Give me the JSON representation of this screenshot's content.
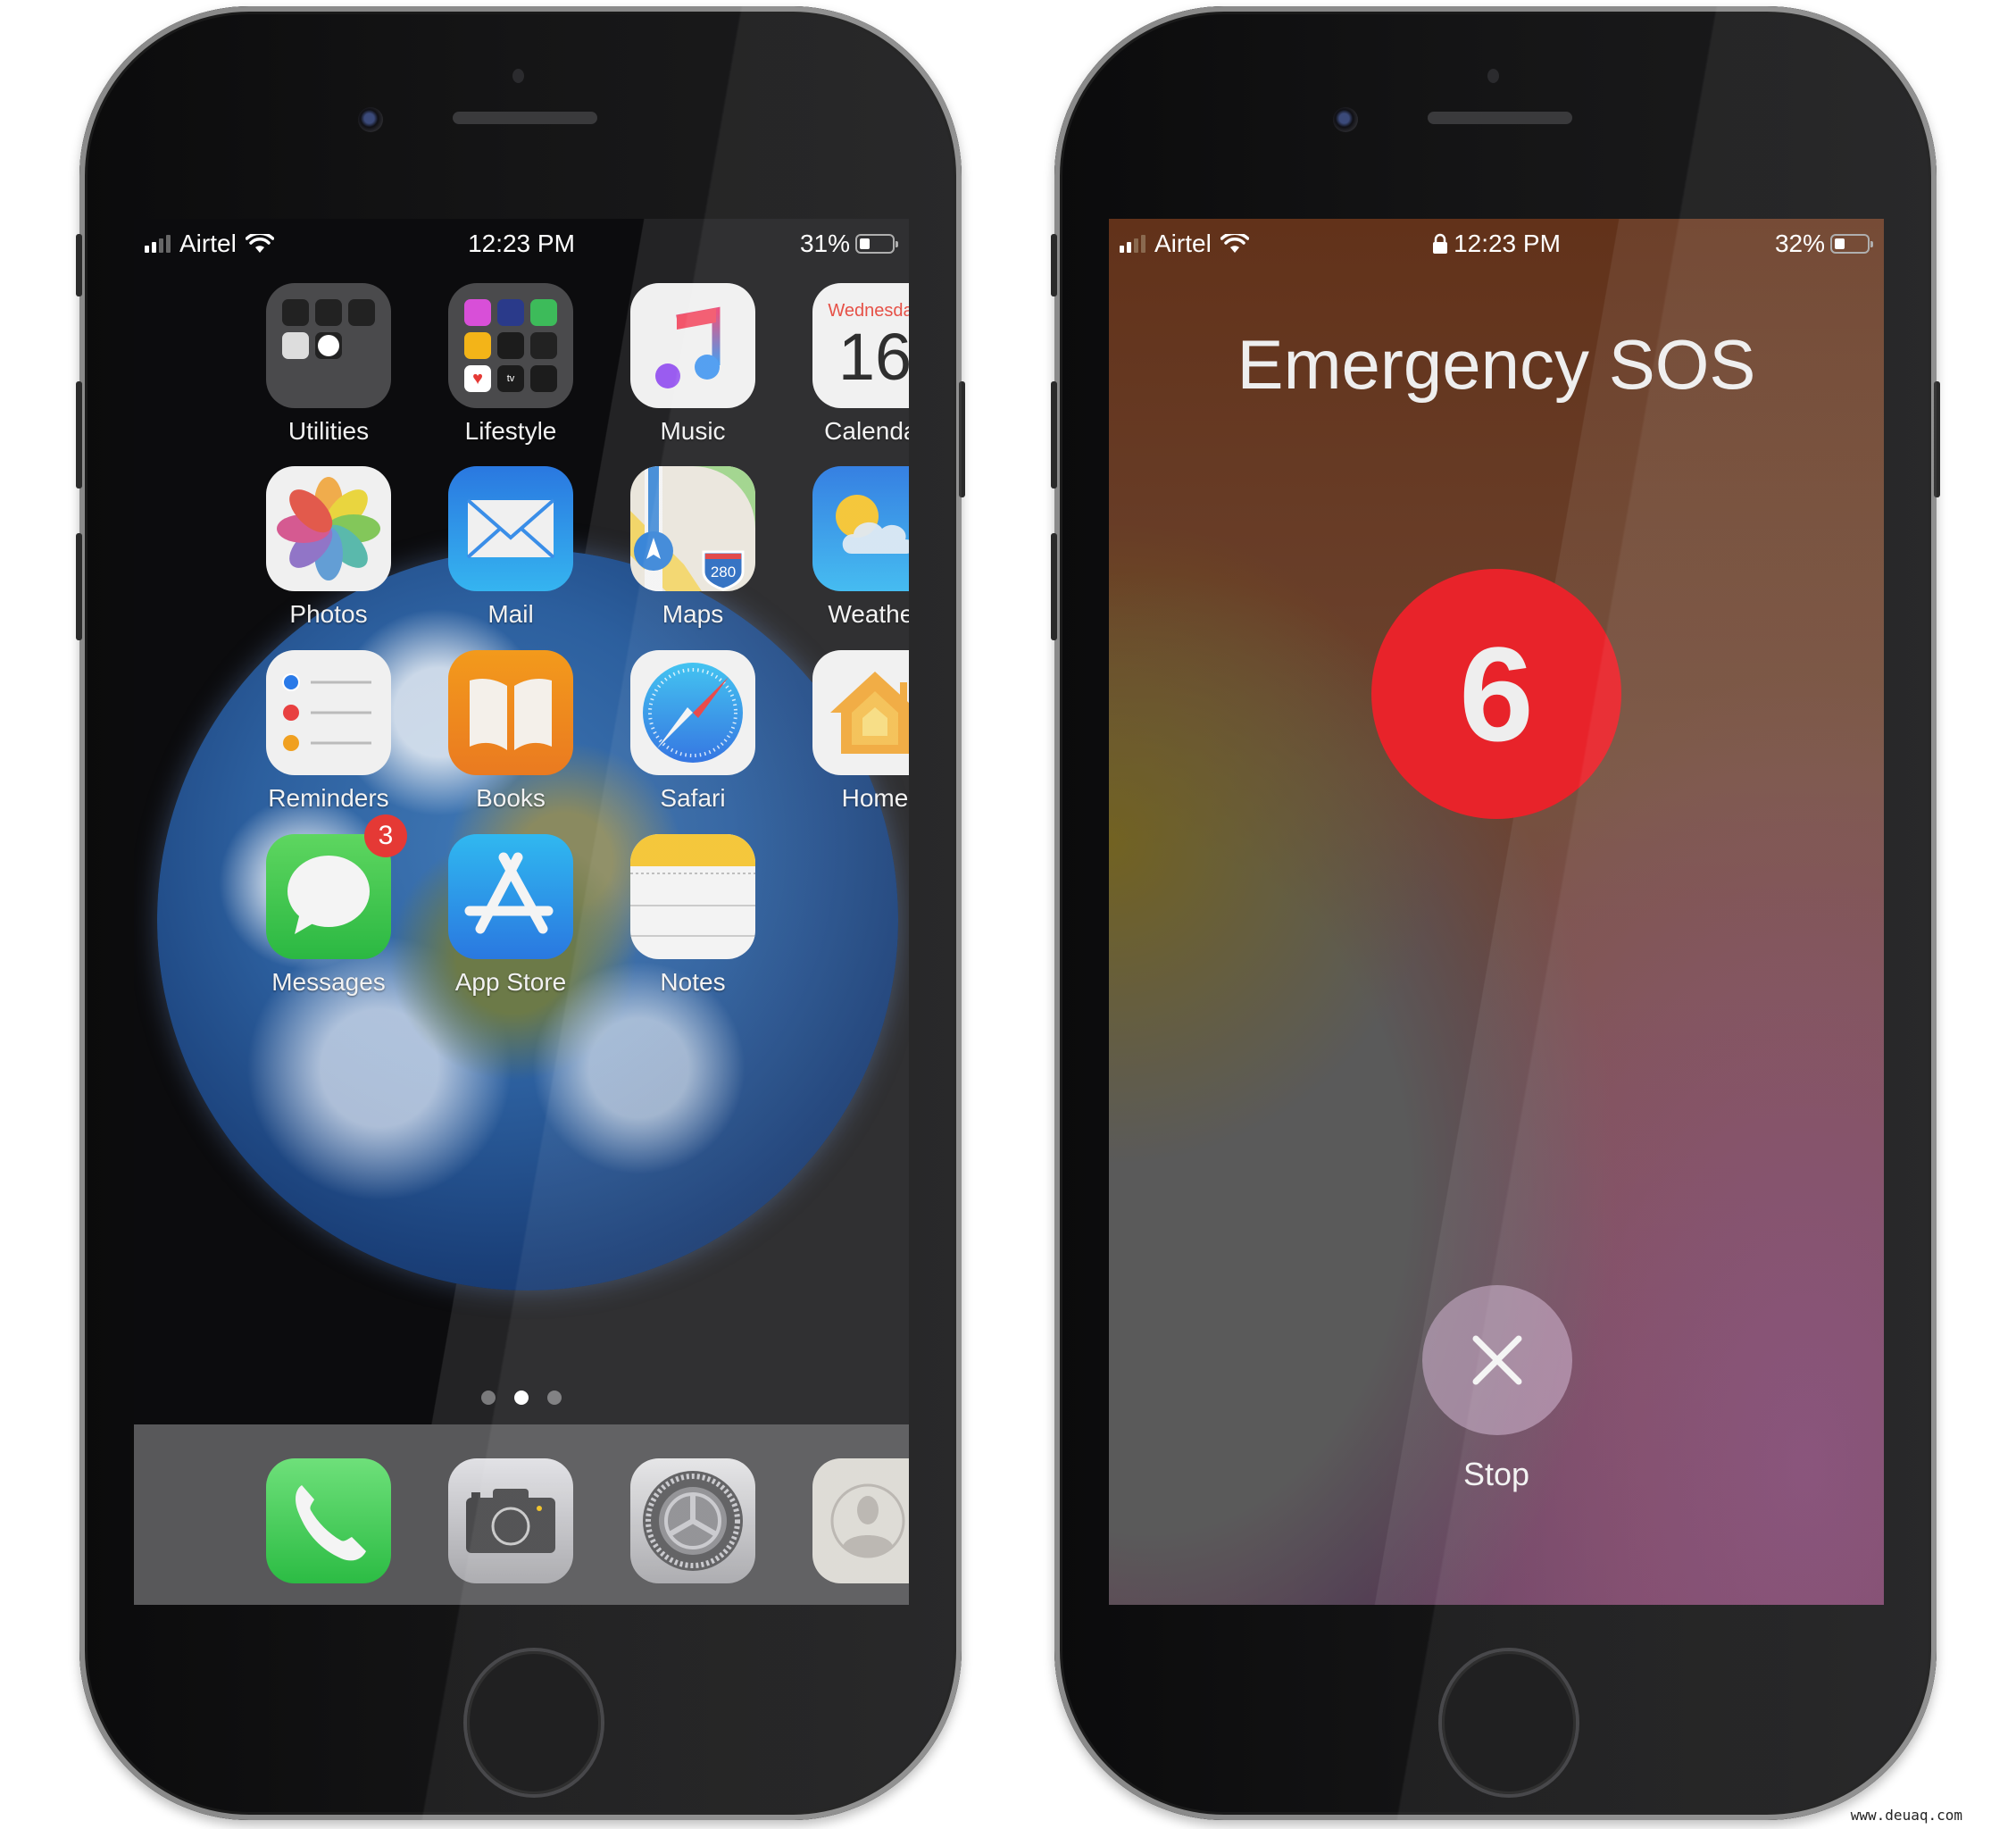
{
  "left_phone": {
    "status_bar": {
      "carrier": "Airtel",
      "time": "12:23 PM",
      "battery_percent": "31%",
      "battery_level": 0.31,
      "signal_bars": 2,
      "signal_bars_total": 4
    },
    "home_screen": {
      "apps": [
        {
          "name": "Utilities",
          "type": "folder",
          "icon": "folder-icon",
          "contents": [
            "voice-memos",
            "compass",
            "measure",
            "calculator",
            "clock"
          ]
        },
        {
          "name": "Lifestyle",
          "type": "folder",
          "icon": "folder-icon",
          "contents": [
            "itunes-store",
            "shortcuts",
            "find-my",
            "tips",
            "watch",
            "wallet",
            "health",
            "tv",
            "stocks"
          ]
        },
        {
          "name": "Music",
          "icon": "music-note-icon"
        },
        {
          "name": "Calendar",
          "icon": "calendar-icon",
          "weekday": "Wednesday",
          "day": "16"
        },
        {
          "name": "Photos",
          "icon": "photos-flower-icon"
        },
        {
          "name": "Mail",
          "icon": "envelope-icon"
        },
        {
          "name": "Maps",
          "icon": "map-icon",
          "shield_number": "280"
        },
        {
          "name": "Weather",
          "icon": "sun-cloud-icon"
        },
        {
          "name": "Reminders",
          "icon": "reminders-list-icon"
        },
        {
          "name": "Books",
          "icon": "open-book-icon"
        },
        {
          "name": "Safari",
          "icon": "compass-icon"
        },
        {
          "name": "Home",
          "icon": "house-icon"
        },
        {
          "name": "Messages",
          "icon": "speech-bubble-icon",
          "badge": "3"
        },
        {
          "name": "App Store",
          "icon": "app-store-icon"
        },
        {
          "name": "Notes",
          "icon": "notepad-icon"
        }
      ],
      "page_count": 3,
      "active_page": 2
    },
    "dock": [
      {
        "name": "Phone",
        "icon": "phone-handset-icon"
      },
      {
        "name": "Camera",
        "icon": "camera-icon"
      },
      {
        "name": "Settings",
        "icon": "gear-icon"
      },
      {
        "name": "Contacts",
        "icon": "contact-card-icon"
      }
    ]
  },
  "right_phone": {
    "status_bar": {
      "carrier": "Airtel",
      "time": "12:23 PM",
      "locked": true,
      "battery_percent": "32%",
      "battery_level": 0.32,
      "signal_bars": 2,
      "signal_bars_total": 4
    },
    "sos": {
      "title": "Emergency SOS",
      "countdown": "6",
      "stop_label": "Stop"
    }
  },
  "colors": {
    "sos_red": "#e8232a",
    "badge_red": "#e53935",
    "calendar_red": "#e5463c"
  },
  "watermark": "www.deuaq.com"
}
